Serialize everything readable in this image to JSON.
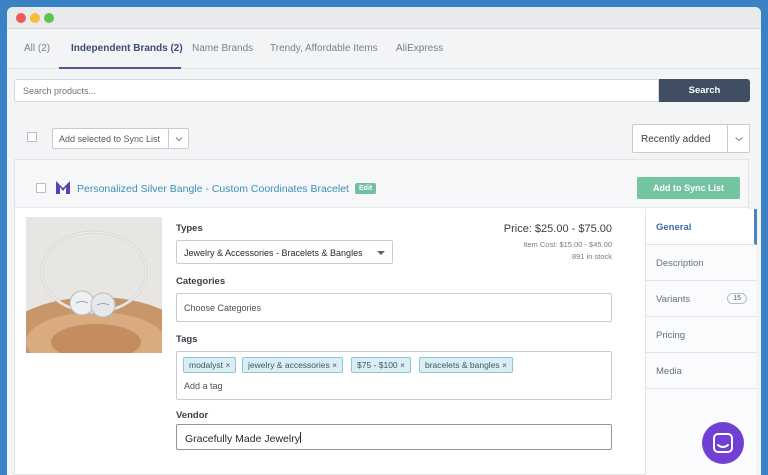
{
  "tabs": [
    {
      "label": "All (2)"
    },
    {
      "label": "Independent Brands (2)"
    },
    {
      "label": "Name Brands"
    },
    {
      "label": "Trendy, Affordable Items"
    },
    {
      "label": "AliExpress"
    }
  ],
  "search": {
    "placeholder": "Search products...",
    "button_label": "Search"
  },
  "toolbar": {
    "bulk_action_label": "Add selected to Sync List",
    "sort_label": "Recently added"
  },
  "product": {
    "title": "Personalized Silver Bangle - Custom Coordinates Bracelet",
    "edit_label": "Edit",
    "add_button_label": "Add to Sync List",
    "price": "Price: $25.00 - $75.00",
    "item_cost": "Item Cost: $15.00 - $45.00",
    "stock": "891 in stock",
    "types_label": "Types",
    "types_value": "Jewelry & Accessories - Bracelets & Bangles",
    "categories_label": "Categories",
    "categories_placeholder": "Choose Categories",
    "tags_label": "Tags",
    "tags": [
      {
        "text": "modalyst ×"
      },
      {
        "text": "jewelry & accessories ×"
      },
      {
        "text": "$75 - $100 ×"
      },
      {
        "text": "bracelets & bangles ×"
      }
    ],
    "add_tag_placeholder": "Add a tag",
    "vendor_label": "Vendor",
    "vendor_value": "Gracefully Made Jewelry"
  },
  "side_tabs": [
    {
      "label": "General"
    },
    {
      "label": "Description"
    },
    {
      "label": "Variants",
      "count": "15"
    },
    {
      "label": "Pricing"
    },
    {
      "label": "Media"
    }
  ],
  "colors": {
    "accent": "#74c4a1",
    "link": "#3d8fb8",
    "chat": "#7040d4"
  }
}
